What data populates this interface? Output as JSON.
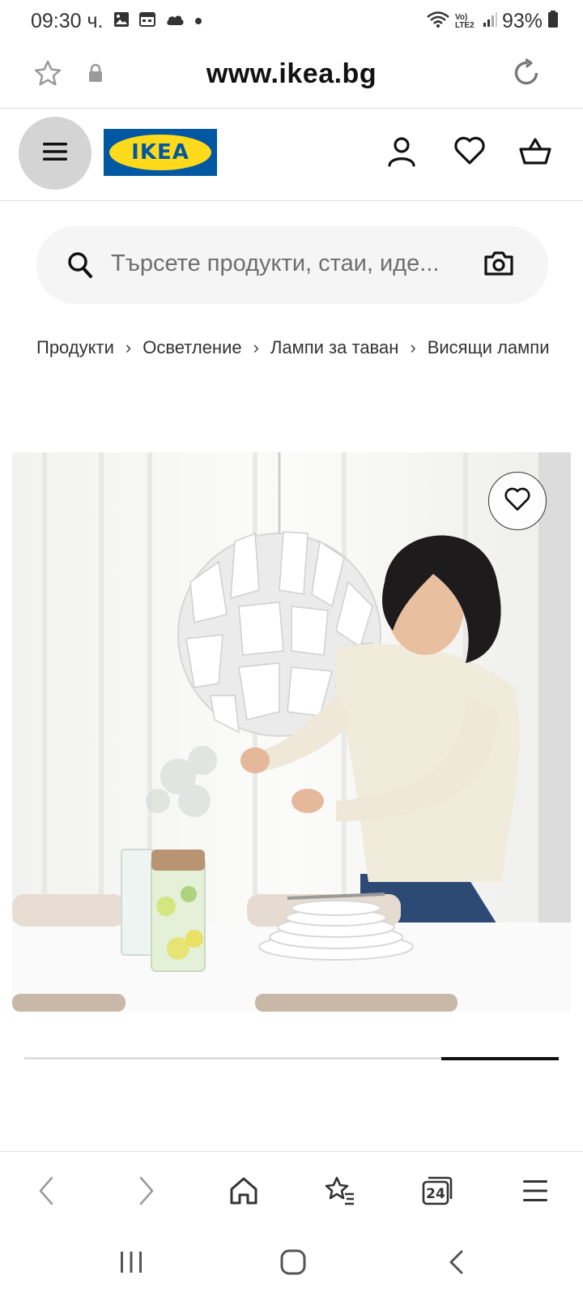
{
  "status_bar": {
    "time": "09:30 ч.",
    "network": "Vo) LTE2",
    "battery": "93%",
    "icons": [
      "image-icon",
      "calendar-icon",
      "cloud-icon",
      "dot-icon",
      "wifi-icon",
      "signal-icon",
      "battery-icon"
    ]
  },
  "browser": {
    "url": "www.ikea.bg",
    "tab_count": "24"
  },
  "header": {
    "logo_text": "IKEA",
    "brand_colors": {
      "blue": "#0058a3",
      "yellow": "#ffda1a"
    }
  },
  "search": {
    "placeholder": "Търсете продукти, стаи, иде..."
  },
  "breadcrumb": {
    "separator": "›",
    "items": [
      "Продукти",
      "Осветление",
      "Лампи за таван",
      "Висящи лампи"
    ]
  },
  "carousel": {
    "progress": 0.22,
    "start": 0.78
  }
}
